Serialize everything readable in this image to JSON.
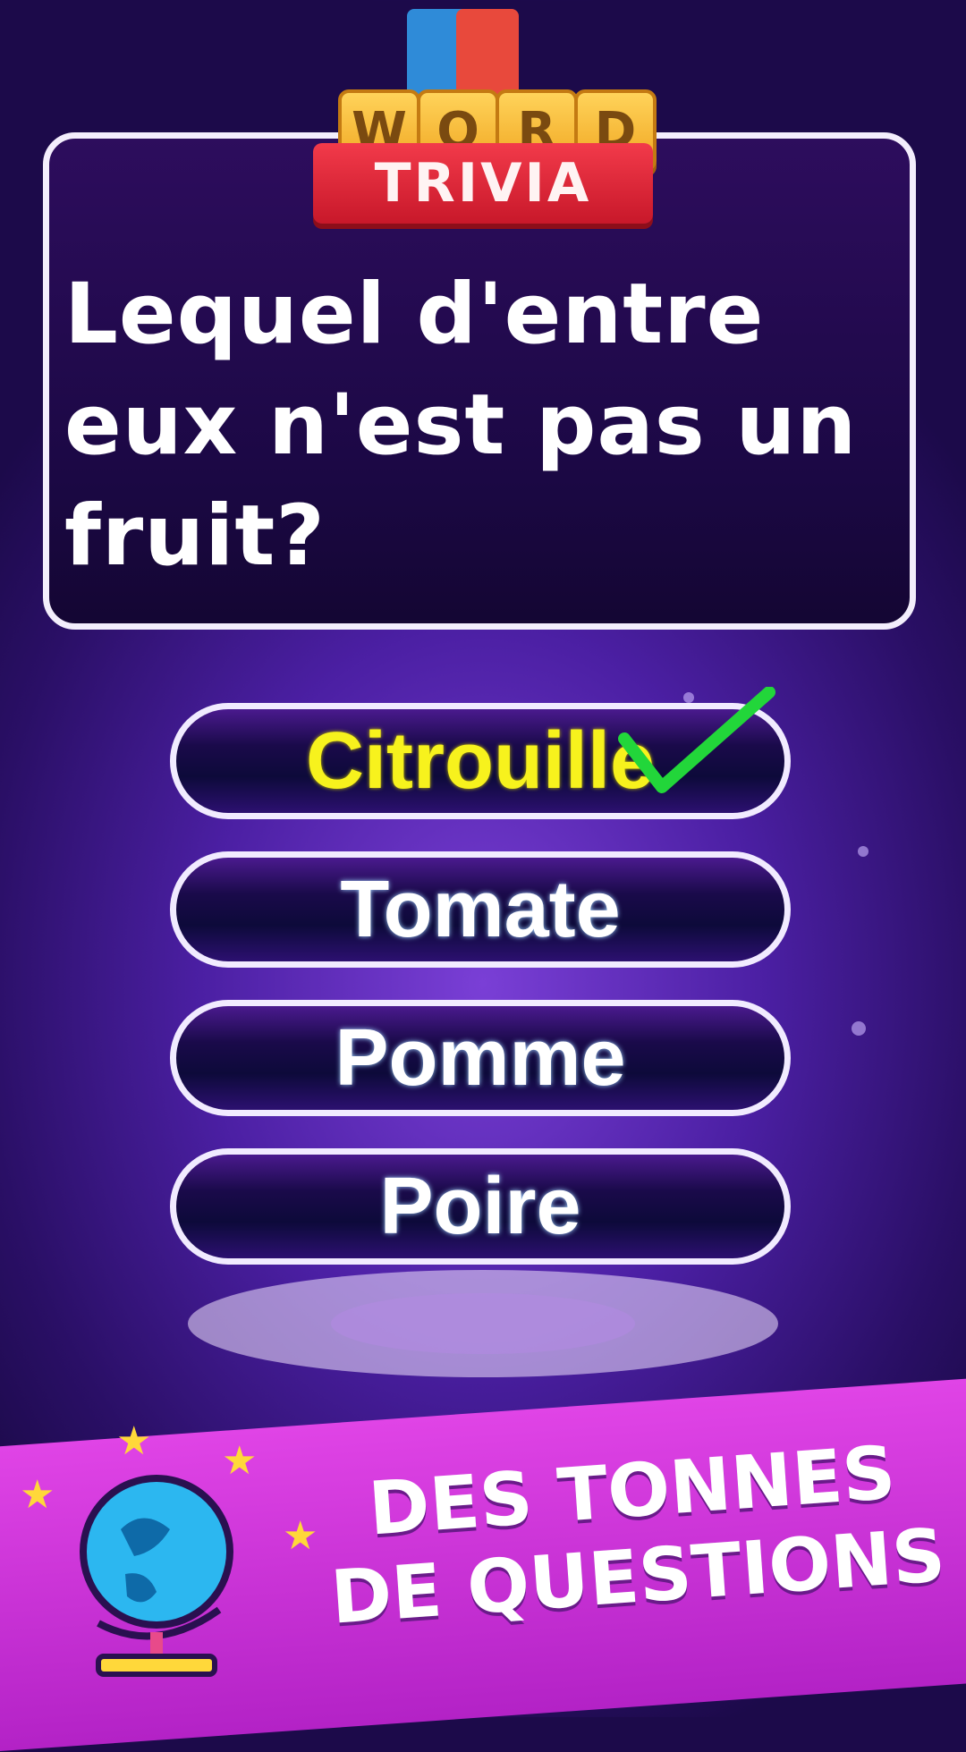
{
  "logo": {
    "tiles": [
      "W",
      "O",
      "R",
      "D"
    ],
    "banner": "TRIVIA"
  },
  "question": "Lequel d'entre eux n'est pas un fruit?",
  "answers": [
    {
      "label": "Citrouille",
      "state": "correct"
    },
    {
      "label": "Tomate",
      "state": "default"
    },
    {
      "label": "Pomme",
      "state": "default"
    },
    {
      "label": "Poire",
      "state": "default"
    }
  ],
  "promo": {
    "line1": "DES TONNES",
    "line2": "DE QUESTIONS"
  },
  "colors": {
    "correct_text": "#f7f21d",
    "checkmark": "#22d63a",
    "banner": "#d23cdc"
  },
  "icons": [
    "checkmark-icon",
    "globe-icon",
    "star-icon"
  ]
}
